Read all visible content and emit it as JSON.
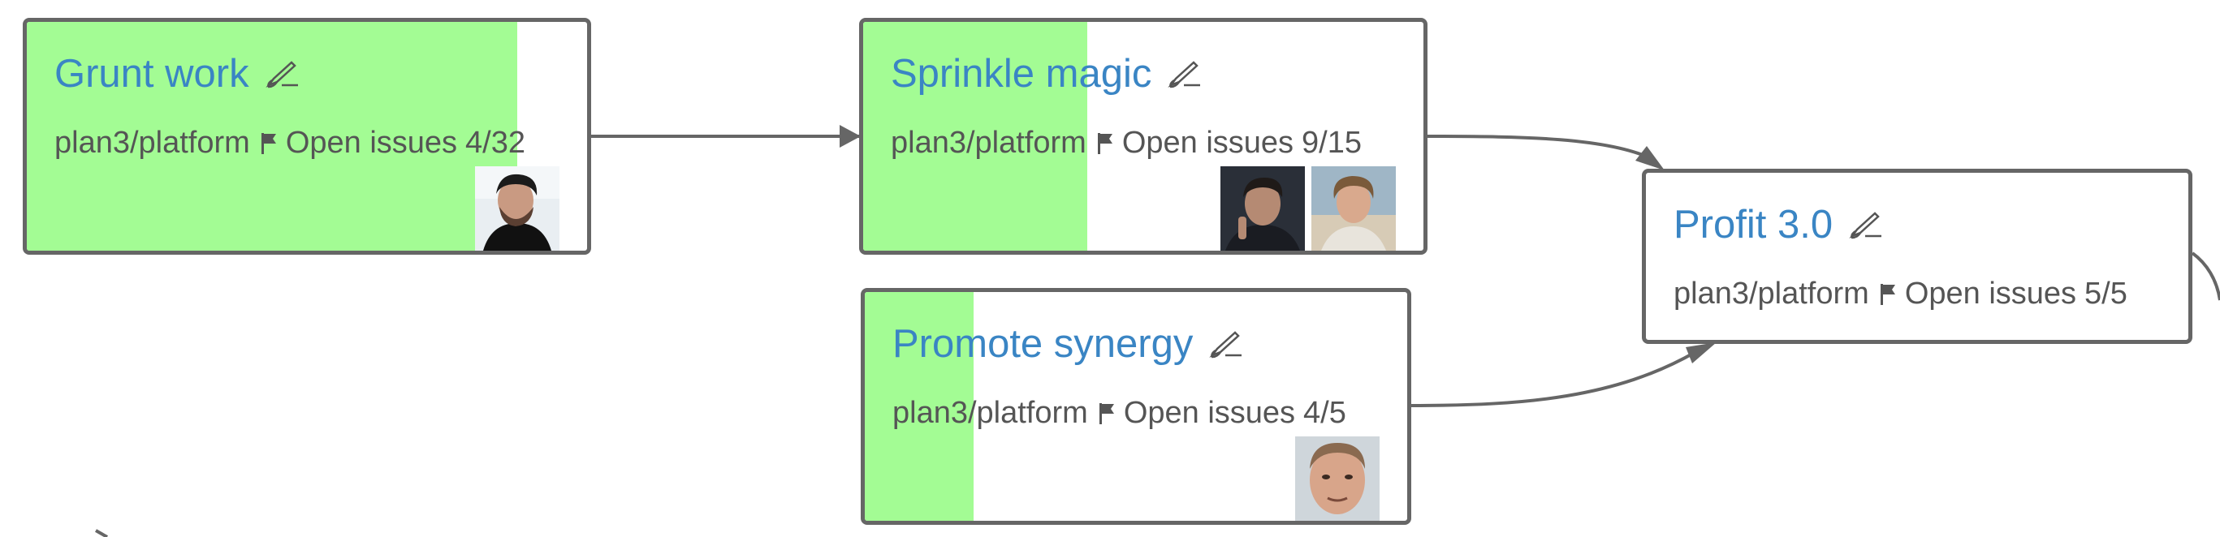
{
  "diagram": {
    "nodes": [
      {
        "id": "grunt-work",
        "title": "Grunt work",
        "repo": "plan3/platform",
        "issues_label": "Open issues",
        "issues_count": "4/32",
        "progress": 0.875,
        "avatars": [
          "avatar-bearded-man-black-hood"
        ]
      },
      {
        "id": "sprinkle-magic",
        "title": "Sprinkle magic",
        "repo": "plan3/platform",
        "issues_label": "Open issues",
        "issues_count": "9/15",
        "progress": 0.4,
        "avatars": [
          "avatar-man-dark-shirt",
          "avatar-man-curly-hair"
        ]
      },
      {
        "id": "promote-synergy",
        "title": "Promote synergy",
        "repo": "plan3/platform",
        "issues_label": "Open issues",
        "issues_count": "4/5",
        "progress": 0.2,
        "avatars": [
          "avatar-man-closeup-face"
        ]
      },
      {
        "id": "profit-3-0",
        "title": "Profit 3.0",
        "repo": "plan3/platform",
        "issues_label": "Open issues",
        "issues_count": "5/5",
        "progress": 0.0,
        "avatars": []
      }
    ],
    "edges": [
      {
        "from": "grunt-work",
        "to": "sprinkle-magic"
      },
      {
        "from": "sprinkle-magic",
        "to": "profit-3-0"
      },
      {
        "from": "promote-synergy",
        "to": "profit-3-0"
      },
      {
        "from": "profit-3-0",
        "to": "offscreen-right"
      }
    ],
    "icons": {
      "edit": "writing-hand-icon",
      "flag": "flag-icon"
    },
    "colors": {
      "progress_fill": "#a3fc94",
      "title": "#3a85c4",
      "border": "#666666",
      "edge": "#666666",
      "meta_text": "#555555"
    }
  }
}
